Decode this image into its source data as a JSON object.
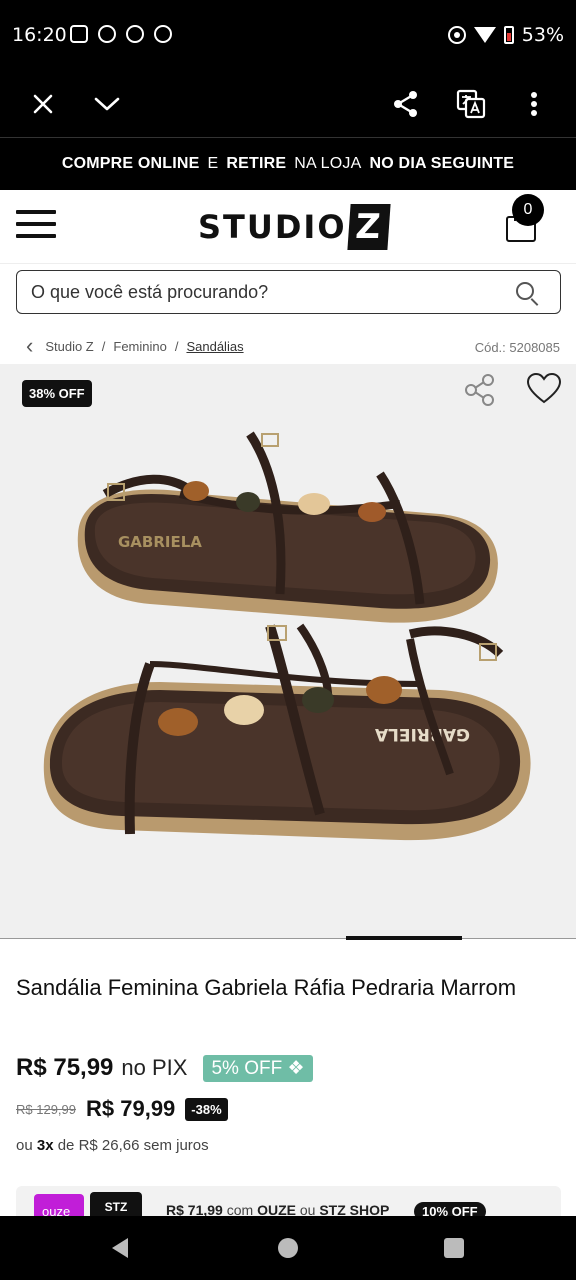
{
  "status_bar": {
    "time": "16:20",
    "battery": "53%"
  },
  "promo": {
    "part1": "COMPRE ONLINE",
    "part2": "E",
    "part3": "RETIRE",
    "part4": "NA LOJA",
    "part5": "NO DIA SEGUINTE"
  },
  "header": {
    "logo_text": "STUDIO",
    "logo_mark": "Z",
    "cart_count": "0"
  },
  "search": {
    "placeholder": "O que você está procurando?"
  },
  "breadcrumb": {
    "items": [
      "Studio Z",
      "Feminino",
      "Sandálias"
    ],
    "separator": "/",
    "sku": "Cód.: 5208085"
  },
  "product": {
    "badge": "38% OFF",
    "brand_on_sole": "GABRIELA",
    "title": "Sandália Feminina Gabriela Ráfia Pedraria Marrom",
    "pix_price": "R$ 75,99",
    "pix_label": "no PIX",
    "pix_off": "5% OFF",
    "old_price": "R$ 129,99",
    "price": "R$ 79,99",
    "discount": "-38%",
    "installments_prefix": "ou",
    "installments_count": "3x",
    "installments_suffix": "de R$ 26,66 sem juros"
  },
  "partner": {
    "ouze": "ouze",
    "stz": "STZ",
    "price": "R$ 71,99",
    "text_com": "com",
    "ouze_name": "OUZE",
    "text_ou": "ou",
    "stz_name": "STZ SHOP",
    "off": "10% OFF"
  }
}
